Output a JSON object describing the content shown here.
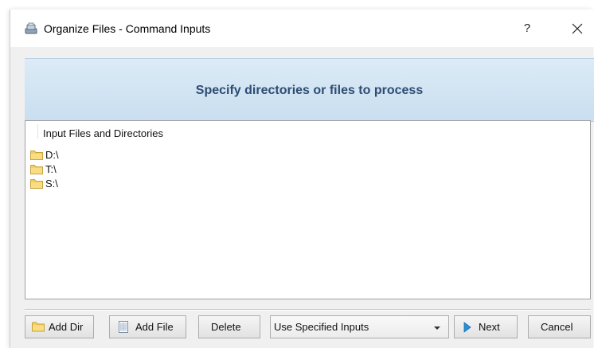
{
  "window": {
    "title": "Organize Files - Command Inputs",
    "help_label": "?"
  },
  "banner": {
    "text": "Specify directories or files to process"
  },
  "list": {
    "header": "Input Files and Directories",
    "items": [
      {
        "label": "D:\\",
        "icon": "folder-icon"
      },
      {
        "label": "T:\\",
        "icon": "folder-icon"
      },
      {
        "label": "S:\\",
        "icon": "folder-icon"
      }
    ]
  },
  "toolbar": {
    "add_dir_label": "Add Dir",
    "add_file_label": "Add File",
    "delete_label": "Delete",
    "input_mode": {
      "selected": "Use Specified Inputs"
    },
    "next_label": "Next",
    "cancel_label": "Cancel"
  },
  "colors": {
    "banner_text": "#2e4c73",
    "banner_bg": "#d2e4f3",
    "folder": "#f3cf63",
    "next_arrow": "#2a8ed8"
  }
}
